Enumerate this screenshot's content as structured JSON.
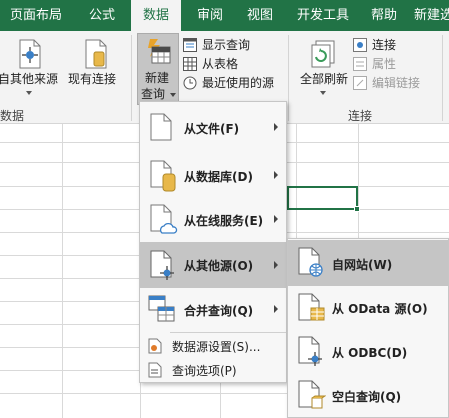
{
  "tabs": [
    "页面布局",
    "公式",
    "数据",
    "审阅",
    "视图",
    "开发工具",
    "帮助",
    "新建选"
  ],
  "ribbon": {
    "from_other_sources": "自其他来源",
    "existing_connections": "现有连接",
    "new_query_line1": "新建",
    "new_query_line2": "查询",
    "show_queries": "显示查询",
    "from_table": "从表格",
    "recent_sources": "最近使用的源",
    "refresh_all": "全部刷新",
    "connections": "连接",
    "properties": "属性",
    "edit_links": "编辑链接",
    "group_data": "数据",
    "group_connections": "连接"
  },
  "menu": {
    "from_file": "从文件(F)",
    "from_database": "从数据库(D)",
    "from_online_services": "从在线服务(E)",
    "from_other_sources": "从其他源(O)",
    "combine_queries": "合并查询(Q)",
    "data_source_settings": "数据源设置(S)...",
    "query_options": "查询选项(P)"
  },
  "submenu": {
    "from_web": "自网站(W)",
    "from_odata": "从 OData 源(O)",
    "from_odbc": "从 ODBC(D)",
    "blank_query": "空白查询(Q)"
  },
  "colors": {
    "excel_green": "#217346",
    "highlight": "#c5c5c5",
    "selection_border": "#217346"
  }
}
